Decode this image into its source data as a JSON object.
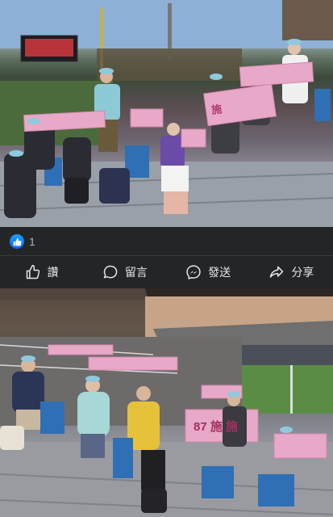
{
  "post": {
    "reactions": {
      "icon": "like-icon",
      "count": "1",
      "color": "#0866ff"
    },
    "actions": [
      {
        "icon": "like-icon",
        "label": "讚"
      },
      {
        "icon": "comment-icon",
        "label": "留言"
      },
      {
        "icon": "messenger-icon",
        "label": "發送"
      },
      {
        "icon": "share-icon",
        "label": "分享"
      }
    ]
  },
  "photos": [
    {
      "banner_text": "施"
    },
    {
      "banner_text": "87 施 施"
    }
  ]
}
